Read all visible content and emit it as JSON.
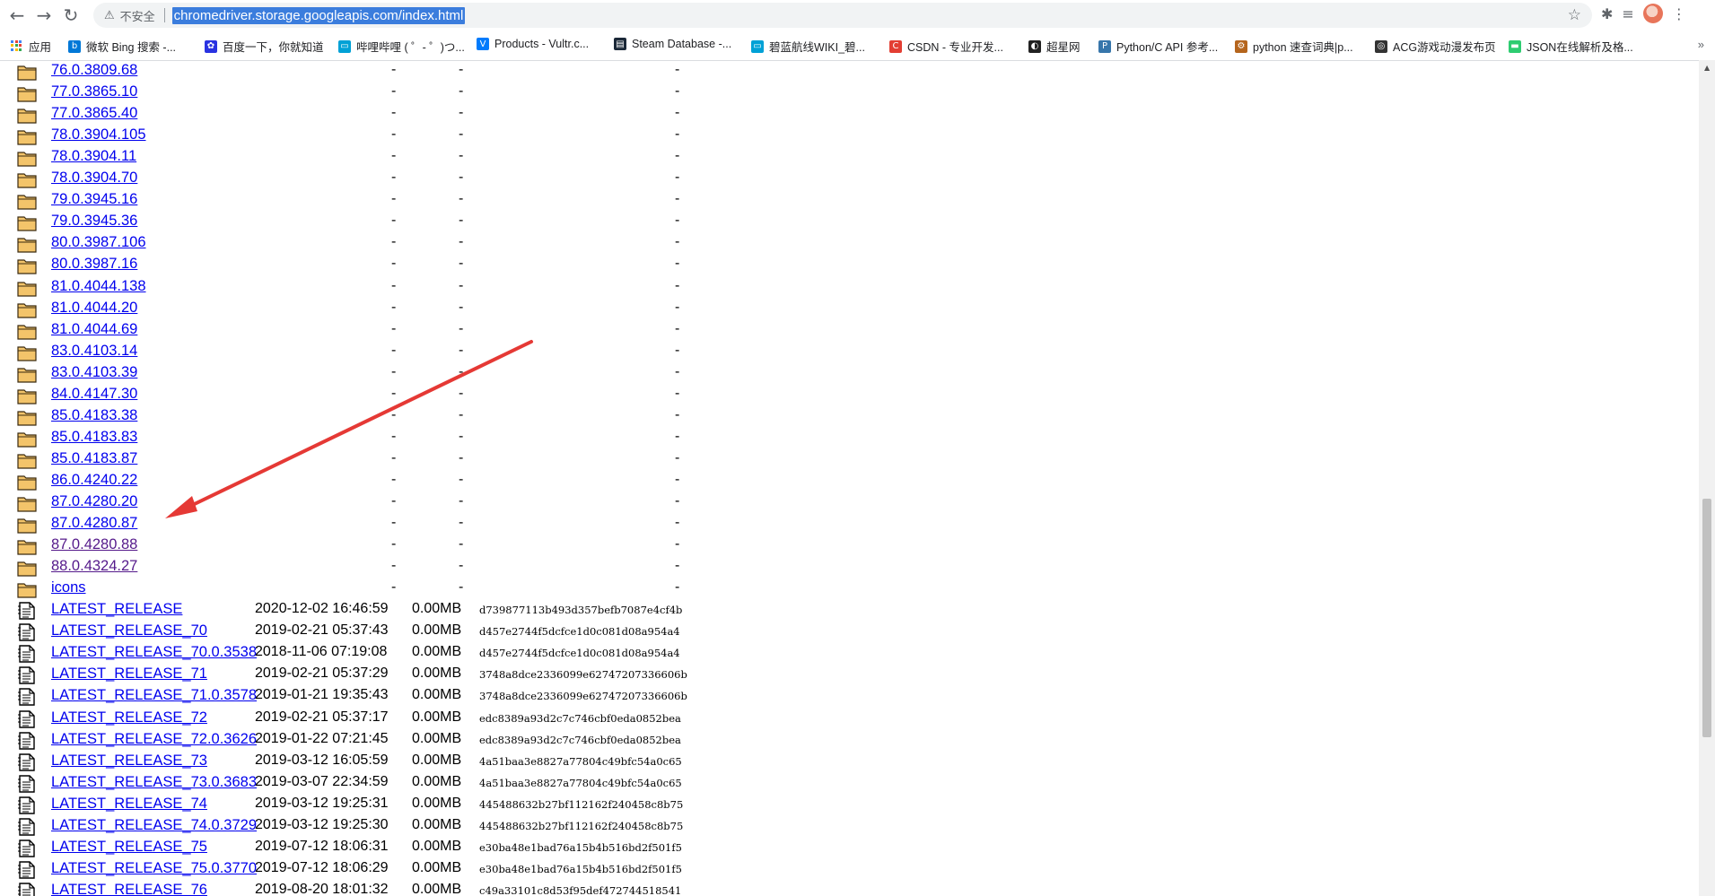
{
  "browser": {
    "security_label": "不安全",
    "url": "chromedriver.storage.googleapis.com/index.html"
  },
  "bookmarks": [
    {
      "label": "应用",
      "icon": "apps-grid-icon"
    },
    {
      "label": "微软 Bing 搜索 -...",
      "icon": "bing-icon"
    },
    {
      "label": "百度一下，你就知道",
      "icon": "baidu-icon"
    },
    {
      "label": "哔哩哔哩 ( ゜- ゜)つ...",
      "icon": "bilibili-icon"
    },
    {
      "label": "Products - Vultr.c...",
      "icon": "vultr-icon"
    },
    {
      "label": "Steam Database -...",
      "icon": "steamdb-icon"
    },
    {
      "label": "碧蓝航线WIKI_碧...",
      "icon": "bilibili-icon"
    },
    {
      "label": "CSDN - 专业开发...",
      "icon": "csdn-icon"
    },
    {
      "label": "超星网",
      "icon": "chaoxing-icon"
    },
    {
      "label": "Python/C API 参考...",
      "icon": "python-icon"
    },
    {
      "label": "python 速查词典|p...",
      "icon": "python-dict-icon"
    },
    {
      "label": "ACG游戏动漫发布页",
      "icon": "acg-icon"
    },
    {
      "label": "JSON在线解析及格...",
      "icon": "json-icon"
    }
  ],
  "bookmarks_more": "»",
  "listing": [
    {
      "name": "76.0.3809.68",
      "type": "dir"
    },
    {
      "name": "77.0.3865.10",
      "type": "dir"
    },
    {
      "name": "77.0.3865.40",
      "type": "dir"
    },
    {
      "name": "78.0.3904.105",
      "type": "dir"
    },
    {
      "name": "78.0.3904.11",
      "type": "dir"
    },
    {
      "name": "78.0.3904.70",
      "type": "dir"
    },
    {
      "name": "79.0.3945.16",
      "type": "dir"
    },
    {
      "name": "79.0.3945.36",
      "type": "dir"
    },
    {
      "name": "80.0.3987.106",
      "type": "dir"
    },
    {
      "name": "80.0.3987.16",
      "type": "dir"
    },
    {
      "name": "81.0.4044.138",
      "type": "dir"
    },
    {
      "name": "81.0.4044.20",
      "type": "dir"
    },
    {
      "name": "81.0.4044.69",
      "type": "dir"
    },
    {
      "name": "83.0.4103.14",
      "type": "dir"
    },
    {
      "name": "83.0.4103.39",
      "type": "dir"
    },
    {
      "name": "84.0.4147.30",
      "type": "dir"
    },
    {
      "name": "85.0.4183.38",
      "type": "dir"
    },
    {
      "name": "85.0.4183.83",
      "type": "dir"
    },
    {
      "name": "85.0.4183.87",
      "type": "dir"
    },
    {
      "name": "86.0.4240.22",
      "type": "dir"
    },
    {
      "name": "87.0.4280.20",
      "type": "dir"
    },
    {
      "name": "87.0.4280.87",
      "type": "dir"
    },
    {
      "name": "87.0.4280.88",
      "type": "dir",
      "visited": true
    },
    {
      "name": "88.0.4324.27",
      "type": "dir",
      "visited": true
    },
    {
      "name": "icons",
      "type": "dir"
    },
    {
      "name": "LATEST_RELEASE",
      "type": "file",
      "modified": "2020-12-02 16:46:59",
      "size": "0.00MB",
      "etag": "d739877113b493d357befb7087e4cf4b"
    },
    {
      "name": "LATEST_RELEASE_70",
      "type": "file",
      "modified": "2019-02-21 05:37:43",
      "size": "0.00MB",
      "etag": "d457e2744f5dcfce1d0c081d08a954a4"
    },
    {
      "name": "LATEST_RELEASE_70.0.3538",
      "type": "file",
      "modified": "2018-11-06 07:19:08",
      "size": "0.00MB",
      "etag": "d457e2744f5dcfce1d0c081d08a954a4"
    },
    {
      "name": "LATEST_RELEASE_71",
      "type": "file",
      "modified": "2019-02-21 05:37:29",
      "size": "0.00MB",
      "etag": "3748a8dce2336099e62747207336606b"
    },
    {
      "name": "LATEST_RELEASE_71.0.3578",
      "type": "file",
      "modified": "2019-01-21 19:35:43",
      "size": "0.00MB",
      "etag": "3748a8dce2336099e62747207336606b"
    },
    {
      "name": "LATEST_RELEASE_72",
      "type": "file",
      "modified": "2019-02-21 05:37:17",
      "size": "0.00MB",
      "etag": "edc8389a93d2c7c746cbf0eda0852bea"
    },
    {
      "name": "LATEST_RELEASE_72.0.3626",
      "type": "file",
      "modified": "2019-01-22 07:21:45",
      "size": "0.00MB",
      "etag": "edc8389a93d2c7c746cbf0eda0852bea"
    },
    {
      "name": "LATEST_RELEASE_73",
      "type": "file",
      "modified": "2019-03-12 16:05:59",
      "size": "0.00MB",
      "etag": "4a51baa3e8827a77804c49bfc54a0c65"
    },
    {
      "name": "LATEST_RELEASE_73.0.3683",
      "type": "file",
      "modified": "2019-03-07 22:34:59",
      "size": "0.00MB",
      "etag": "4a51baa3e8827a77804c49bfc54a0c65"
    },
    {
      "name": "LATEST_RELEASE_74",
      "type": "file",
      "modified": "2019-03-12 19:25:31",
      "size": "0.00MB",
      "etag": "445488632b27bf112162f240458c8b75"
    },
    {
      "name": "LATEST_RELEASE_74.0.3729",
      "type": "file",
      "modified": "2019-03-12 19:25:30",
      "size": "0.00MB",
      "etag": "445488632b27bf112162f240458c8b75"
    },
    {
      "name": "LATEST_RELEASE_75",
      "type": "file",
      "modified": "2019-07-12 18:06:31",
      "size": "0.00MB",
      "etag": "e30ba48e1bad76a15b4b516bd2f501f5"
    },
    {
      "name": "LATEST_RELEASE_75.0.3770",
      "type": "file",
      "modified": "2019-07-12 18:06:29",
      "size": "0.00MB",
      "etag": "e30ba48e1bad76a15b4b516bd2f501f5"
    },
    {
      "name": "LATEST_RELEASE_76",
      "type": "file",
      "modified": "2019-08-20 18:01:32",
      "size": "0.00MB",
      "etag": "c49a33101c8d53f95def472744518541"
    }
  ],
  "dash": "-",
  "colors": {
    "link": "#0000ee",
    "visited": "#551a8b",
    "arrow": "#e53935",
    "url_highlight": "#3b7ddd"
  }
}
